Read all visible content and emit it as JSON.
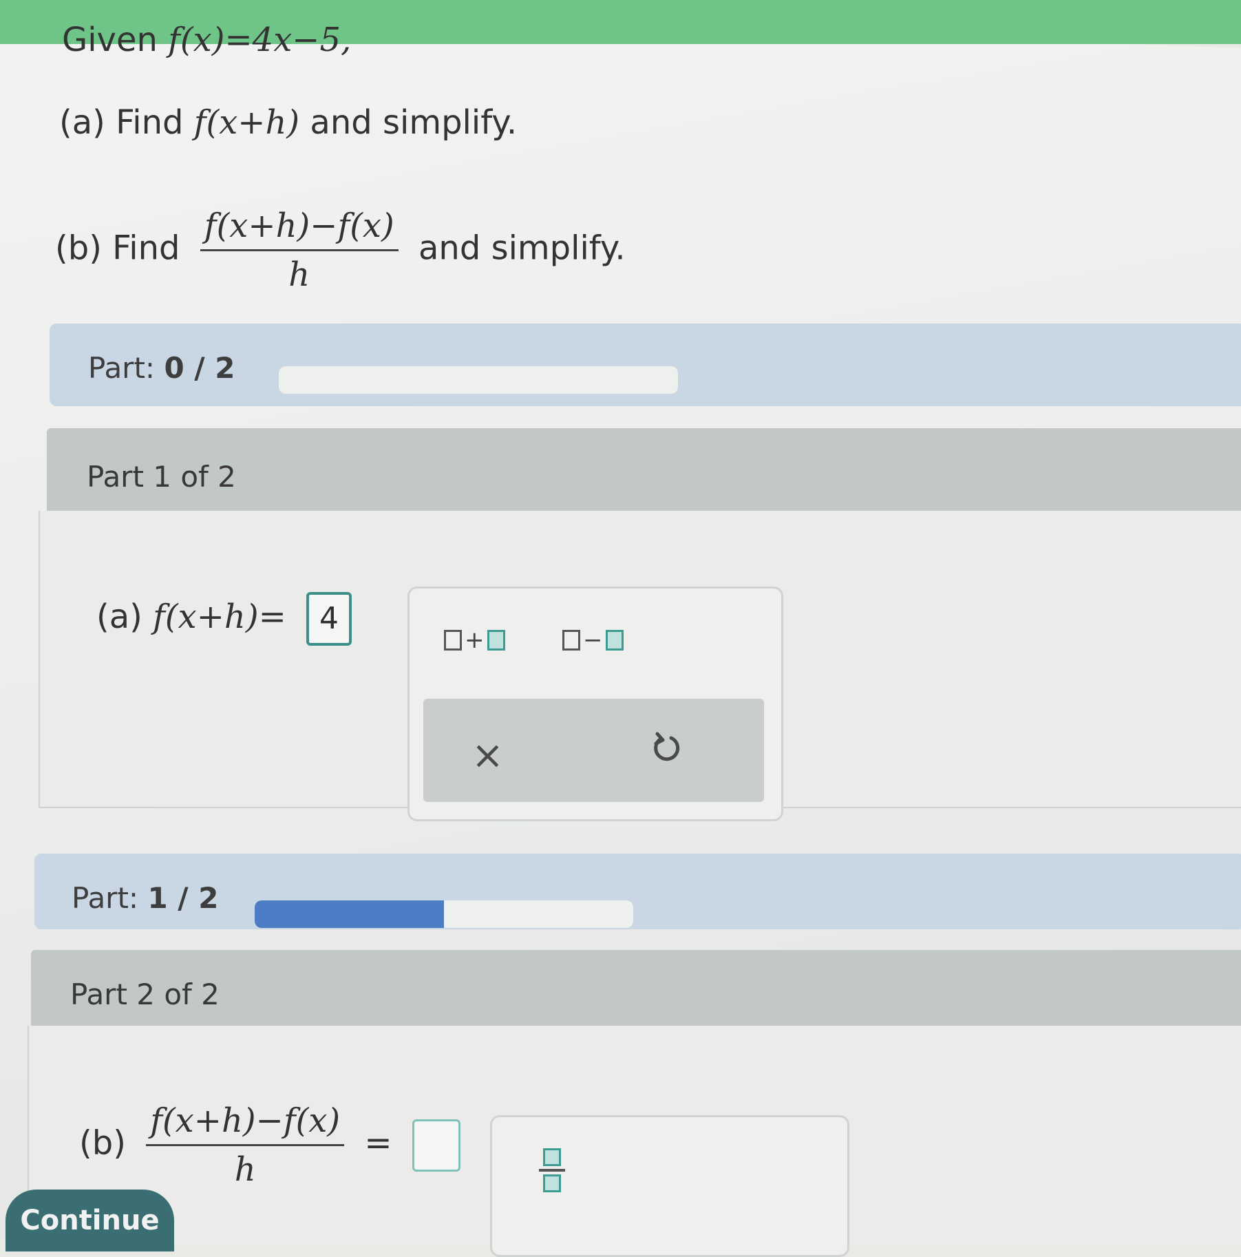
{
  "question": {
    "given_prefix": "Given",
    "given_expr": "f(x)=4x−5,",
    "a_prefix": "(a) Find",
    "a_expr": "f(x+h)",
    "a_suffix": "and simplify.",
    "b_prefix": "(b) Find",
    "b_numerator": "f(x+h)−f(x)",
    "b_denominator": "h",
    "b_suffix": "and simplify."
  },
  "part_progress_1": {
    "label": "Part:",
    "value": "0 / 2",
    "fraction": 0.0
  },
  "part1": {
    "title": "Part 1 of 2",
    "eq_label": "(a)",
    "eq_expr": "f(x+h)=",
    "answer_value": "4"
  },
  "keypad1": {
    "plus_op": "+",
    "minus_op": "−",
    "clear_symbol": "×"
  },
  "part_progress_2": {
    "label": "Part:",
    "value": "1 / 2",
    "fraction": 0.5
  },
  "part2": {
    "title": "Part 2 of 2",
    "eq_label": "(b)",
    "numerator": "f(x+h)−f(x)",
    "denominator": "h",
    "equals": "=",
    "answer_value": ""
  },
  "continue_label": "Continue",
  "colors": {
    "accent_green": "#6fc487",
    "progress_blue": "#4c7cc4",
    "answer_teal": "#3c8f88",
    "button_teal": "#3a6e72"
  },
  "icons": {
    "clear": "x-icon",
    "undo": "undo-icon",
    "fraction": "fraction-template-icon"
  }
}
